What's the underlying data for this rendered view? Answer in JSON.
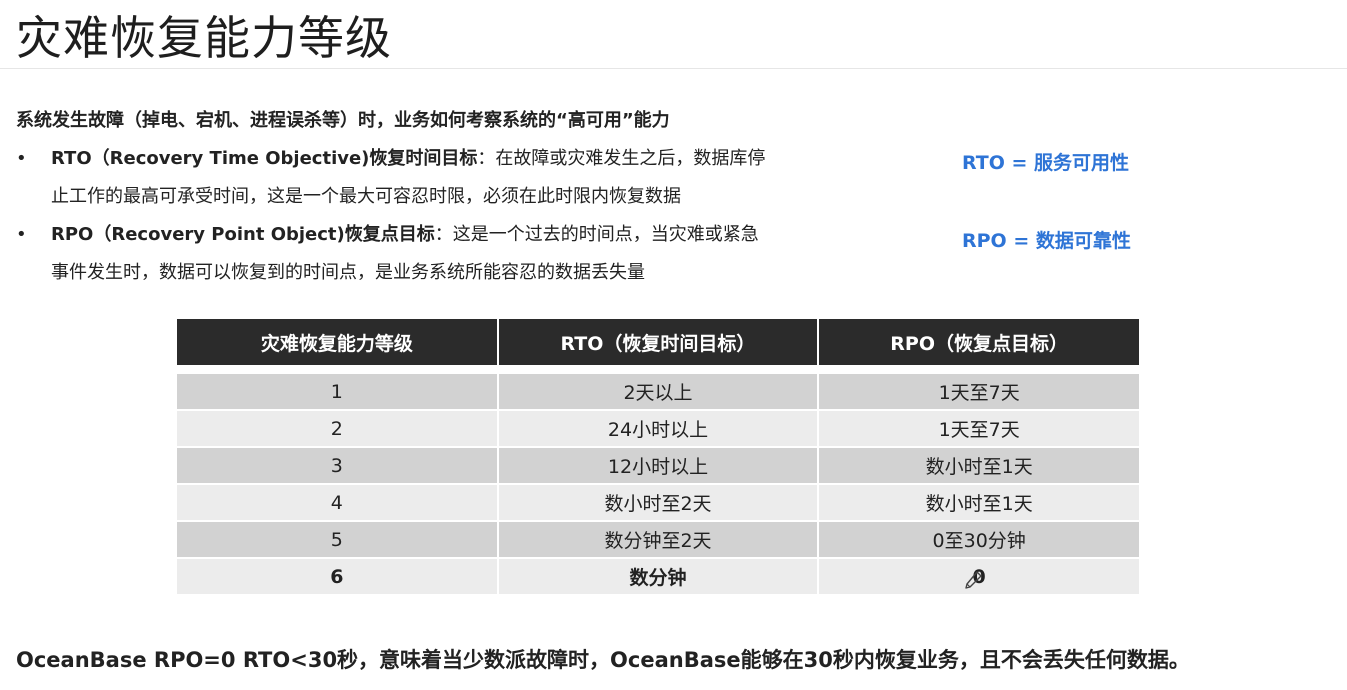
{
  "slide": {
    "title": "灾难恢复能力等级",
    "intro": "系统发生故障（掉电、宕机、进程误杀等）时，业务如何考察系统的“高可用”能力",
    "bullet_marker": "•",
    "bullets": [
      {
        "term": "RTO（Recovery Time Objective)恢复时间目标",
        "desc_line1": "：在故障或灾难发生之后，数据库停",
        "desc_line2": "止工作的最高可承受时间，这是一个最大可容忍时限，必须在此时限内恢复数据"
      },
      {
        "term": "RPO（Recovery Point Object)恢复点目标",
        "desc_line1": "：这是一个过去的时间点，当灾难或紧急",
        "desc_line2": "事件发生时，数据可以恢复到的时间点，是业务系统所能容忍的数据丢失量"
      }
    ],
    "side_notes": {
      "rto": "RTO = 服务可用性",
      "rpo": "RPO = 数据可靠性"
    },
    "accent_color": "#2e74d6",
    "table": {
      "headers": [
        "灾难恢复能力等级",
        "RTO（恢复时间目标）",
        "RPO（恢复点目标）"
      ],
      "rows": [
        [
          "1",
          "2天以上",
          "1天至7天"
        ],
        [
          "2",
          "24小时以上",
          "1天至7天"
        ],
        [
          "3",
          "12小时以上",
          "数小时至1天"
        ],
        [
          "4",
          "数小时至2天",
          "数小时至1天"
        ],
        [
          "5",
          "数分钟至2天",
          "0至30分钟"
        ],
        [
          "6",
          "数分钟",
          "0"
        ]
      ]
    },
    "footer": "OceanBase RPO=0 RTO<30秒，意味着当少数派故障时，OceanBase能够在30秒内恢复业务，且不会丢失任何数据。"
  }
}
